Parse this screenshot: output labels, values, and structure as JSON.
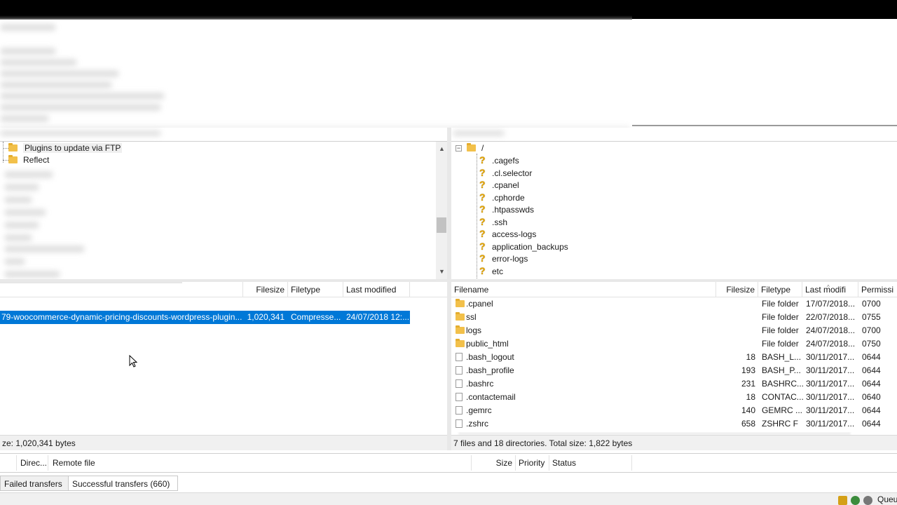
{
  "local_tree": {
    "items": [
      {
        "label": "Plugins to update via FTP"
      },
      {
        "label": "Reflect"
      }
    ]
  },
  "remote_tree": {
    "root": "/",
    "items": [
      ".cagefs",
      ".cl.selector",
      ".cpanel",
      ".cphorde",
      ".htpasswds",
      ".ssh",
      "access-logs",
      "application_backups",
      "error-logs",
      "etc"
    ]
  },
  "local_list": {
    "columns": {
      "filesize": "Filesize",
      "filetype": "Filetype",
      "modified": "Last modified"
    },
    "rows": [
      {
        "name": "79-woocommerce-dynamic-pricing-discounts-wordpress-plugin...",
        "size": "1,020,341",
        "type": "Compresse...",
        "modified": "24/07/2018 12:..."
      }
    ],
    "status": "ze: 1,020,341 bytes"
  },
  "remote_list": {
    "columns": {
      "name": "Filename",
      "filesize": "Filesize",
      "filetype": "Filetype",
      "modified": "Last modifi",
      "perms": "Permissi"
    },
    "rows": [
      {
        "name": ".cpanel",
        "kind": "folder",
        "size": "",
        "type": "File folder",
        "modified": "17/07/2018...",
        "perms": "0700"
      },
      {
        "name": "ssl",
        "kind": "folder",
        "size": "",
        "type": "File folder",
        "modified": "22/07/2018...",
        "perms": "0755"
      },
      {
        "name": "logs",
        "kind": "folder",
        "size": "",
        "type": "File folder",
        "modified": "24/07/2018...",
        "perms": "0700"
      },
      {
        "name": "public_html",
        "kind": "folder",
        "size": "",
        "type": "File folder",
        "modified": "24/07/2018...",
        "perms": "0750"
      },
      {
        "name": ".bash_logout",
        "kind": "file",
        "size": "18",
        "type": "BASH_L...",
        "modified": "30/11/2017...",
        "perms": "0644"
      },
      {
        "name": ".bash_profile",
        "kind": "file",
        "size": "193",
        "type": "BASH_P...",
        "modified": "30/11/2017...",
        "perms": "0644"
      },
      {
        "name": ".bashrc",
        "kind": "file",
        "size": "231",
        "type": "BASHRC...",
        "modified": "30/11/2017...",
        "perms": "0644"
      },
      {
        "name": ".contactemail",
        "kind": "file",
        "size": "18",
        "type": "CONTAC...",
        "modified": "30/11/2017...",
        "perms": "0640"
      },
      {
        "name": ".gemrc",
        "kind": "file",
        "size": "140",
        "type": "GEMRC ...",
        "modified": "30/11/2017...",
        "perms": "0644"
      },
      {
        "name": ".zshrc",
        "kind": "file",
        "size": "658",
        "type": "ZSHRC F",
        "modified": "30/11/2017...",
        "perms": "0644"
      }
    ],
    "status": "7 files and 18 directories. Total size: 1,822 bytes"
  },
  "queue": {
    "columns": {
      "direction": "Direc...",
      "remote": "Remote file",
      "size": "Size",
      "priority": "Priority",
      "status": "Status"
    },
    "tabs": {
      "failed": "Failed transfers",
      "successful": "Successful transfers (660)"
    }
  },
  "statusbar": {
    "text": "Queu"
  },
  "colors": {
    "selection": "#0078d7",
    "folder": "#f2c04a",
    "unknown": "#e5a500"
  }
}
